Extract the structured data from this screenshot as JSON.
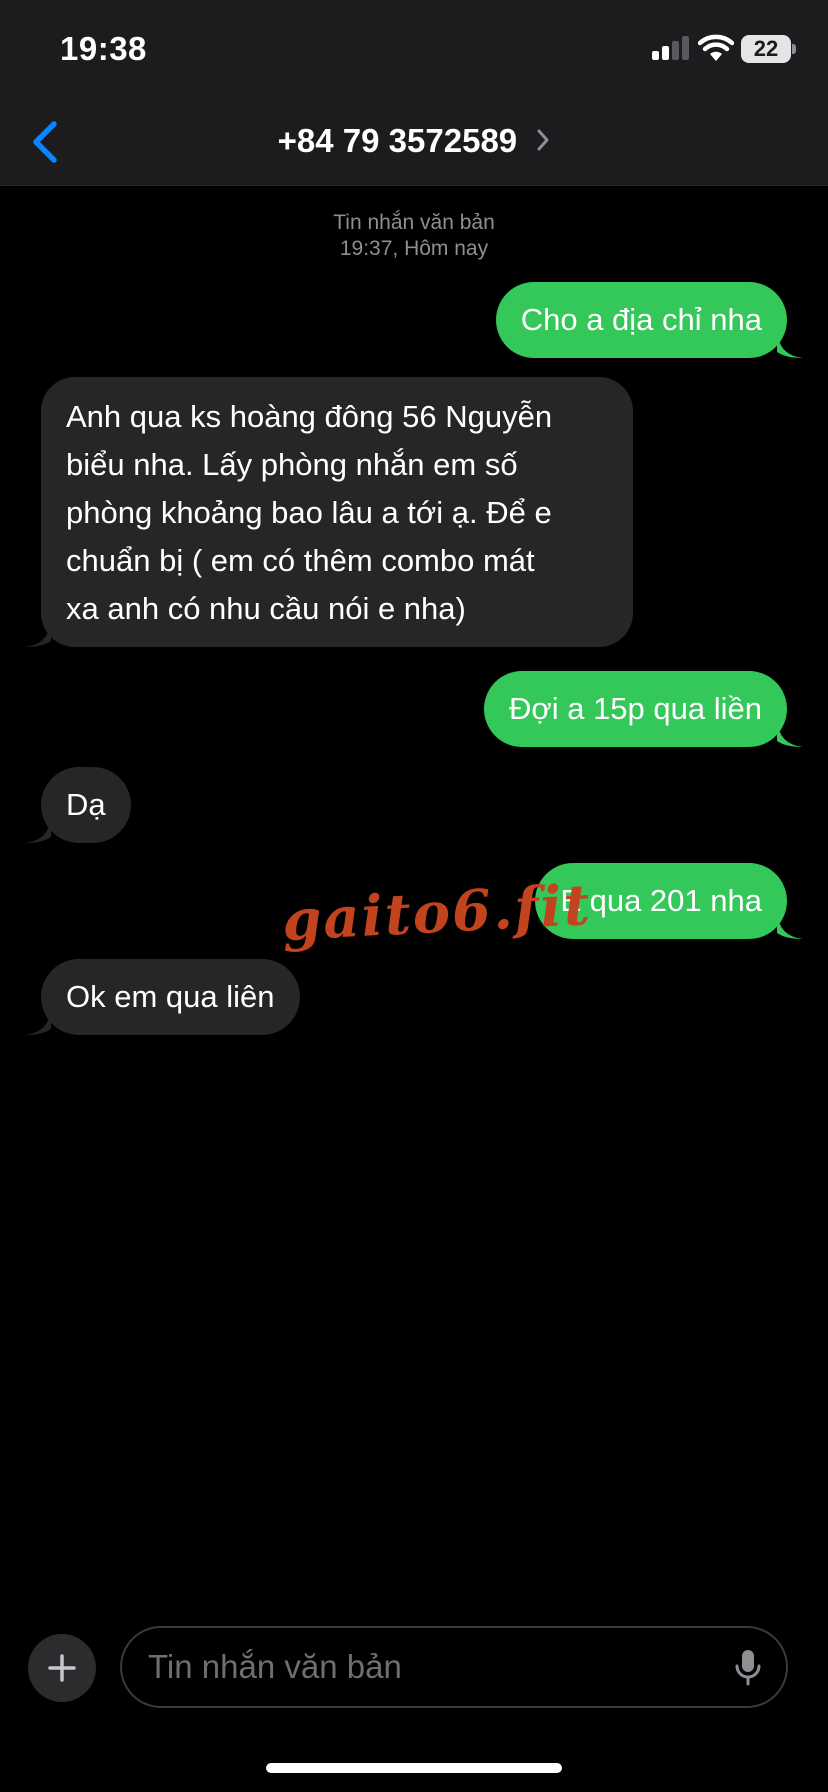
{
  "status_bar": {
    "time": "19:38",
    "battery": "22"
  },
  "header": {
    "title": "+84 79 3572589"
  },
  "thread": {
    "type": "Tin nhắn văn bản",
    "timestamp": "19:37, Hôm nay"
  },
  "messages": [
    {
      "direction": "out",
      "text": "Cho a địa chỉ nha"
    },
    {
      "direction": "in",
      "lines": [
        "Anh qua ks hoàng đông 56 Nguyễn",
        "biểu nha. Lấy phòng nhắn em số",
        "phòng khoảng bao lâu a tới ạ. Để e",
        "chuẩn bị ( em có thêm combo mát",
        "xa anh có nhu cầu nói e nha)"
      ]
    },
    {
      "direction": "out",
      "text": "Đợi a 15p qua liền"
    },
    {
      "direction": "in",
      "text": "Dạ"
    },
    {
      "direction": "out",
      "text": "E qua 201 nha"
    },
    {
      "direction": "in",
      "text": "Ok em qua liên"
    }
  ],
  "watermark": "gaito6.fit",
  "composer": {
    "placeholder": "Tin nhắn văn bản"
  },
  "colors": {
    "outgoing": "#34c759",
    "incoming": "#262628",
    "accent": "#0a84ff"
  }
}
